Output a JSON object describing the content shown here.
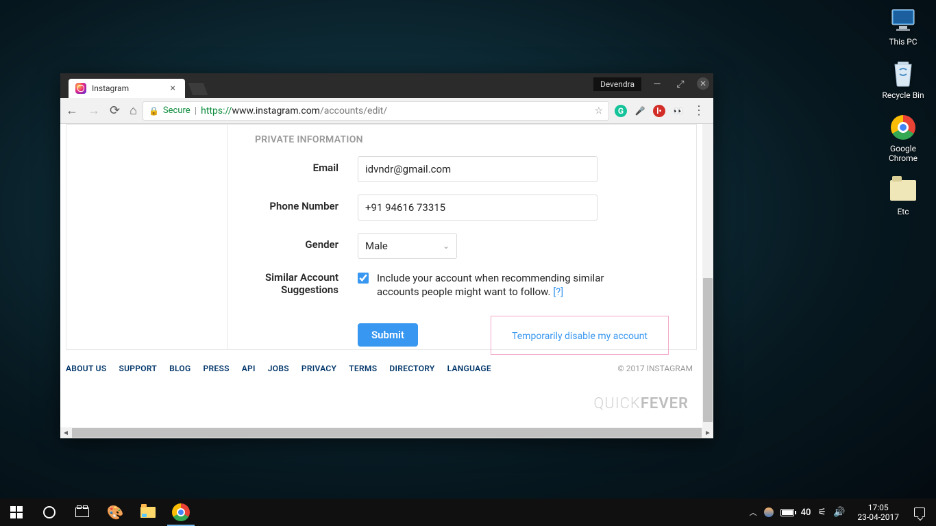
{
  "desktop": {
    "icons": [
      {
        "label": "This PC"
      },
      {
        "label": "Recycle Bin"
      },
      {
        "label": "Google Chrome"
      },
      {
        "label": "Etc"
      }
    ]
  },
  "chrome": {
    "user_badge": "Devendra",
    "tab_title": "Instagram",
    "url": {
      "secure": "Secure",
      "scheme": "https://",
      "domain": "www.instagram.com",
      "path": "/accounts/edit/"
    }
  },
  "page": {
    "section_title": "PRIVATE INFORMATION",
    "labels": {
      "email": "Email",
      "phone": "Phone Number",
      "gender": "Gender",
      "similar1": "Similar Account",
      "similar2": "Suggestions"
    },
    "values": {
      "email": "idvndr@gmail.com",
      "phone": "+91 94616 73315",
      "gender": "Male"
    },
    "checkbox_text": "Include your account when recommending similar accounts people might want to follow.",
    "help_link": "[?]",
    "submit": "Submit",
    "disable_link": "Temporarily disable my account"
  },
  "footer": {
    "links": [
      "ABOUT US",
      "SUPPORT",
      "BLOG",
      "PRESS",
      "API",
      "JOBS",
      "PRIVACY",
      "TERMS",
      "DIRECTORY",
      "LANGUAGE"
    ],
    "copyright": "© 2017 INSTAGRAM",
    "watermark_a": "QUICK",
    "watermark_b": "FEVER"
  },
  "taskbar": {
    "temp": "40",
    "time": "17:05",
    "date": "23-04-2017"
  }
}
